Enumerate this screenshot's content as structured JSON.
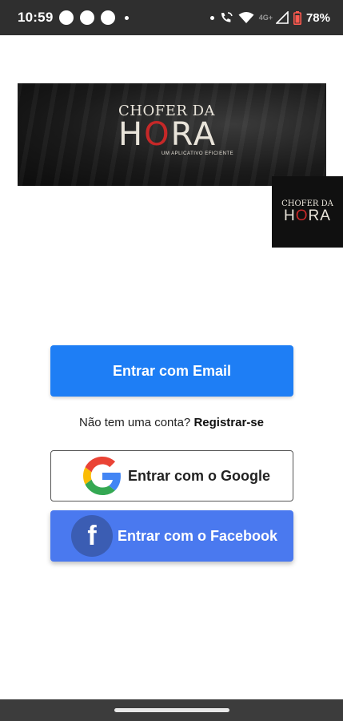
{
  "status_bar": {
    "time": "10:59",
    "network_label": "4G+",
    "battery": "78%"
  },
  "banner": {
    "logo_top": "CHOFER DA",
    "logo_main_1": "H",
    "logo_main_pin": "O",
    "logo_main_2": "RA",
    "logo_sub": "UM APLICATIVO EFICIENTE"
  },
  "logo_square": {
    "top": "CHOFER DA",
    "main_1": "H",
    "main_pin": "O",
    "main_2": "RA"
  },
  "login": {
    "email_button": "Entrar com Email",
    "register_prompt": "Não tem uma conta?",
    "register_link": "Registrar-se",
    "google_button": "Entrar com o Google",
    "facebook_button": "Entrar com o Facebook",
    "facebook_icon_letter": "f"
  },
  "colors": {
    "email_button": "#1e7ef5",
    "facebook_button": "#4a79ef",
    "status_bar": "#2f2f2f"
  }
}
